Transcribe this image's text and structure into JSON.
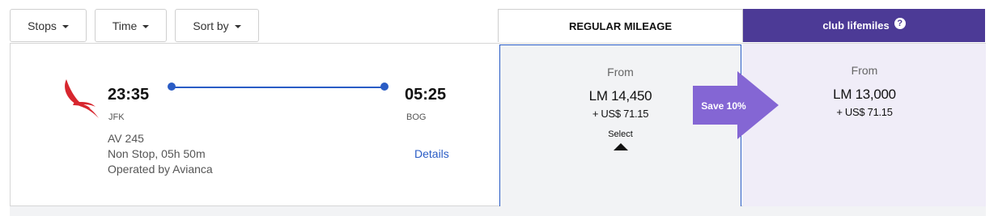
{
  "filters": {
    "stops_label": "Stops",
    "time_label": "Time",
    "sort_label": "Sort by"
  },
  "columns": {
    "regular_label": "REGULAR MILEAGE",
    "club_label": "club lifemiles",
    "club_color": "#4c3a96"
  },
  "flight": {
    "airline_logo": "avianca-bird-logo",
    "departure_time": "23:35",
    "departure_code": "JFK",
    "arrival_time": "05:25",
    "arrival_code": "BOG",
    "flight_number": "AV 245",
    "stops_duration": "Non Stop, 05h 50m",
    "operated_by": "Operated by Avianca",
    "details_label": "Details",
    "route_color": "#2a5cc5"
  },
  "fares": {
    "regular": {
      "from_label": "From",
      "miles": "LM 14,450",
      "cash": "+ US$ 71.15",
      "select_label": "Select"
    },
    "club": {
      "from_label": "From",
      "miles": "LM 13,000",
      "cash": "+ US$ 71.15"
    },
    "save_badge": "Save 10%",
    "save_color": "#8466d4"
  }
}
